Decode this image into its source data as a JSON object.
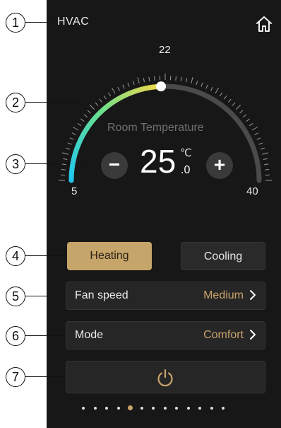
{
  "header": {
    "title": "HVAC",
    "home_icon": "home-icon"
  },
  "dial": {
    "top_label": "22",
    "min_label": "5",
    "max_label": "40",
    "room_temperature_label": "Room Temperature",
    "temperature_whole": "25",
    "temperature_unit": "℃",
    "temperature_decimal": ".0",
    "setpoint": 22,
    "range": [
      5,
      40
    ],
    "gradient_colors": [
      "#1ec8f0",
      "#6ee08a",
      "#f2d64a"
    ],
    "track_color": "#4a4a4a",
    "minus_label": "−",
    "plus_label": "+"
  },
  "modes": {
    "heating_label": "Heating",
    "cooling_label": "Cooling",
    "selected": "Heating"
  },
  "fan": {
    "label": "Fan speed",
    "value": "Medium"
  },
  "mode_row": {
    "label": "Mode",
    "value": "Comfort"
  },
  "power": {
    "icon": "power-icon"
  },
  "pager": {
    "count": 13,
    "active_index": 4,
    "accent": "#c9a46a"
  },
  "callouts": [
    "1",
    "2",
    "3",
    "4",
    "5",
    "6",
    "7"
  ]
}
